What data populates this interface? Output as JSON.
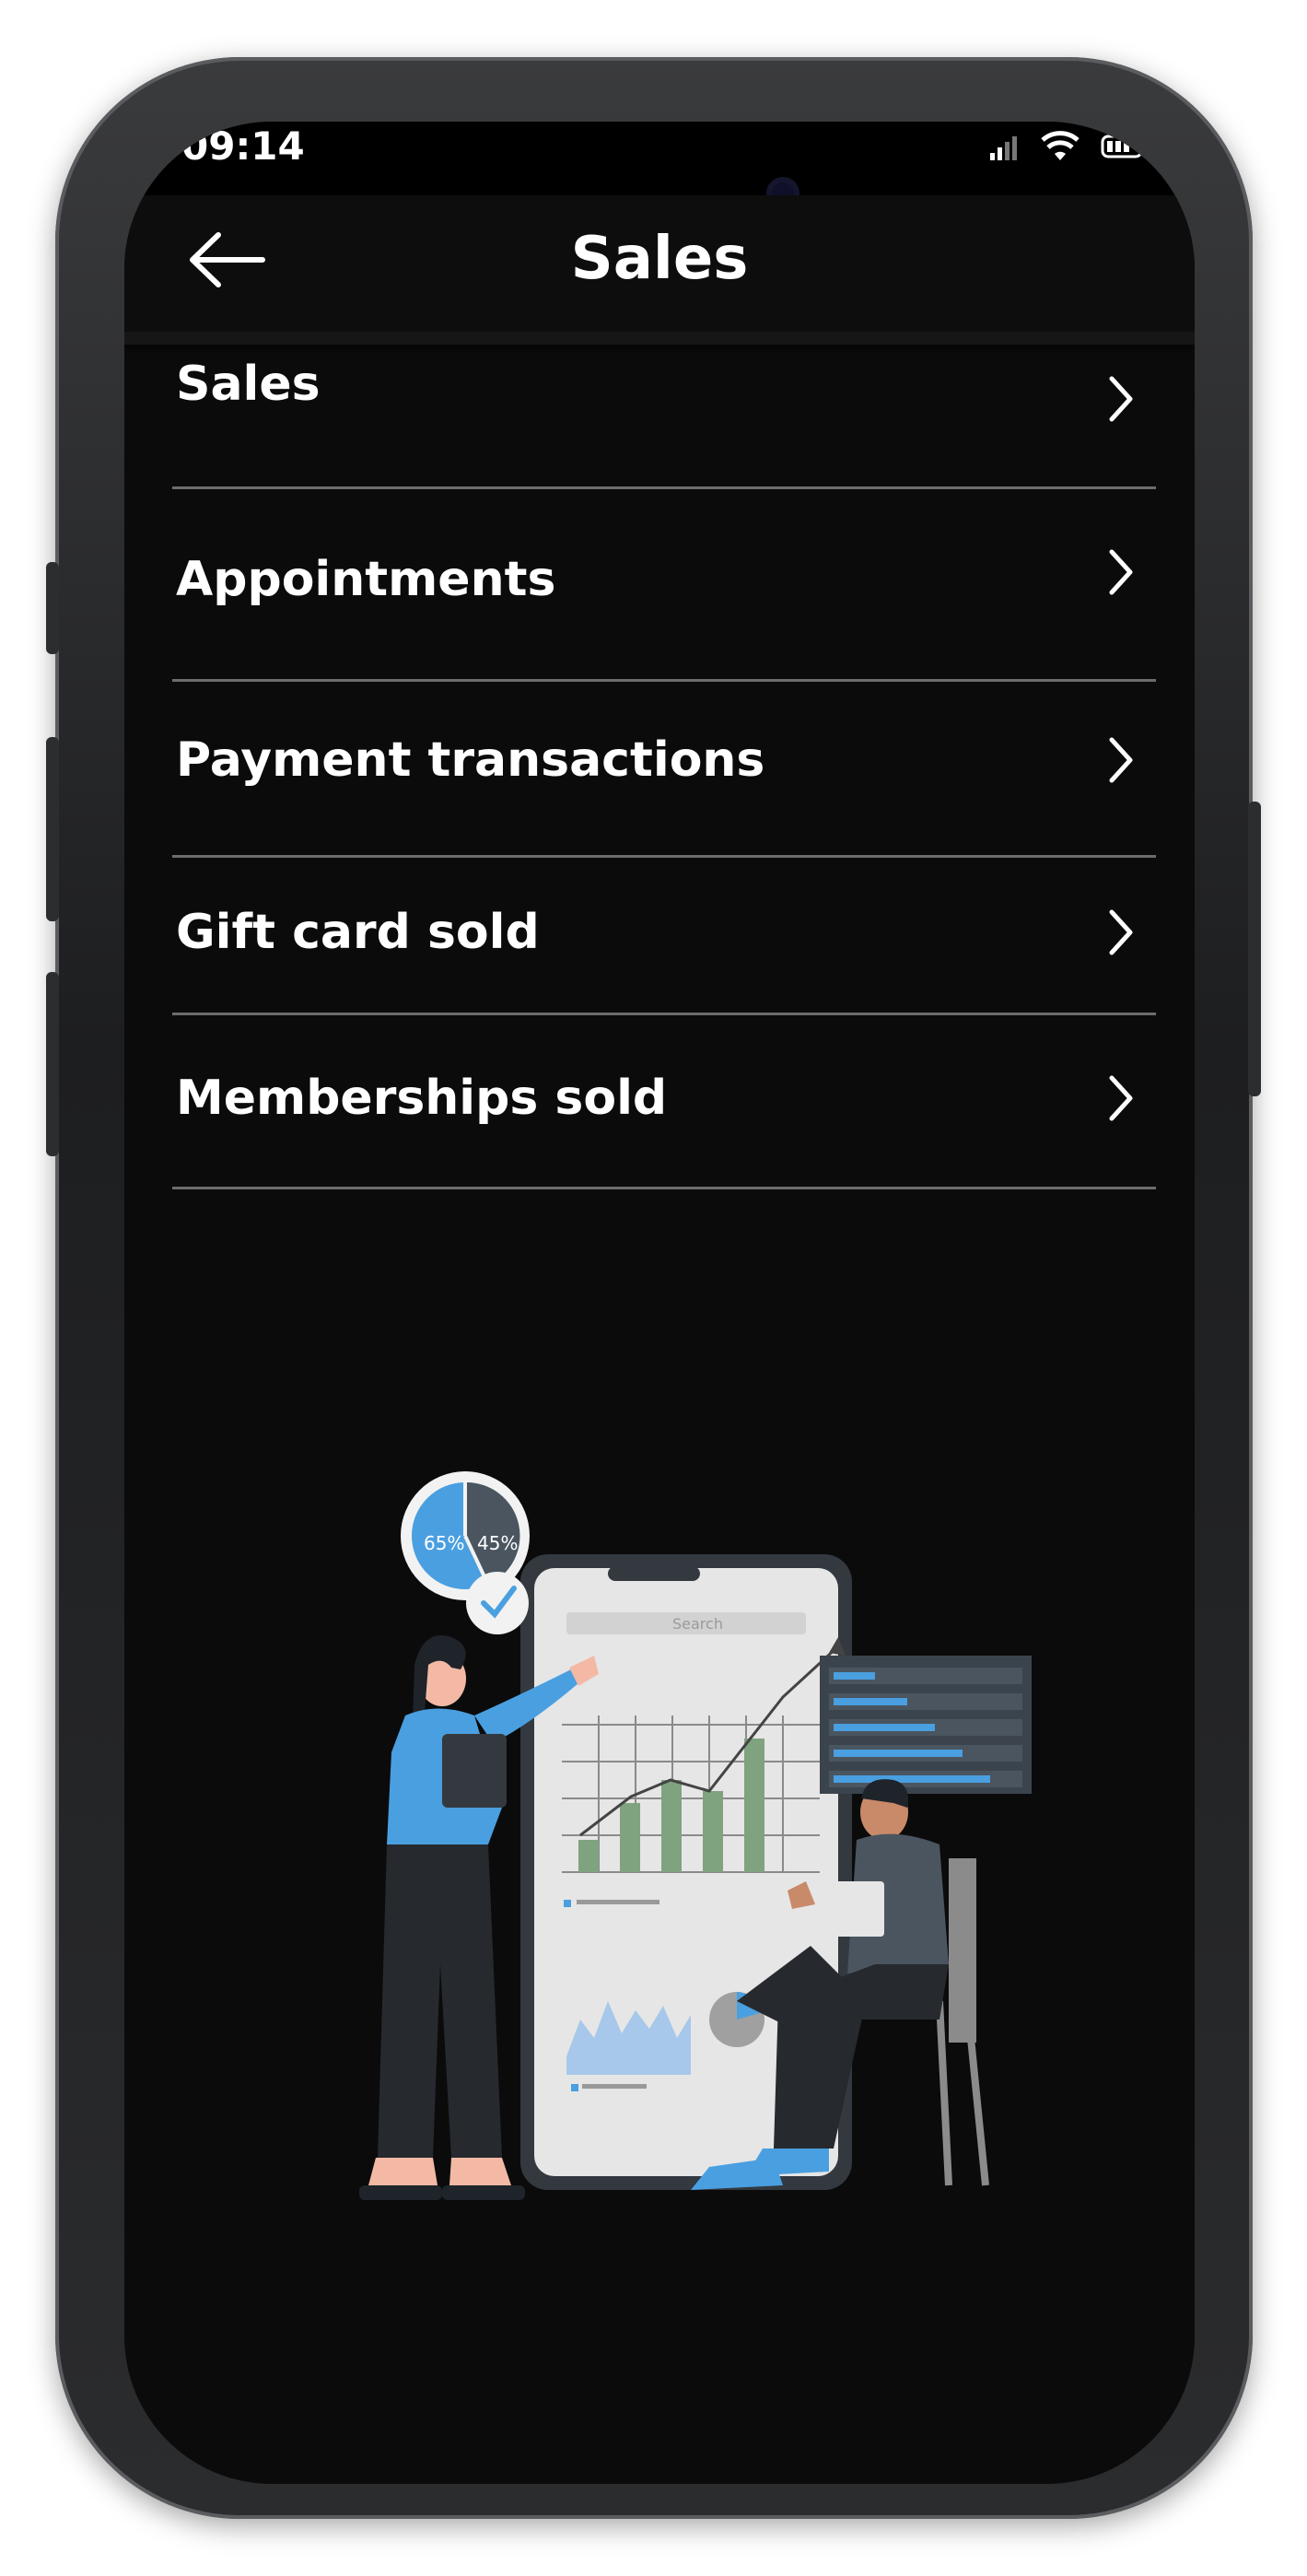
{
  "status_bar": {
    "time": "09:14",
    "icons": [
      "signal-icon",
      "wifi-icon",
      "battery-icon"
    ]
  },
  "header": {
    "title": "Sales",
    "back_icon": "back-arrow-icon"
  },
  "menu": {
    "items": [
      {
        "label": "Sales",
        "icon": "chevron-right-icon"
      },
      {
        "label": "Appointments",
        "icon": "chevron-right-icon"
      },
      {
        "label": "Payment transactions",
        "icon": "chevron-right-icon"
      },
      {
        "label": "Gift card sold",
        "icon": "chevron-right-icon"
      },
      {
        "label": "Memberships sold",
        "icon": "chevron-right-icon"
      }
    ]
  },
  "illustration": {
    "pie_left_label": "65%",
    "pie_right_label": "45%",
    "search_label": "Search"
  },
  "colors": {
    "background": "#0b0b0b",
    "text": "#ffffff",
    "divider": "#6d6d6d",
    "accent_blue": "#4a9fe0"
  }
}
